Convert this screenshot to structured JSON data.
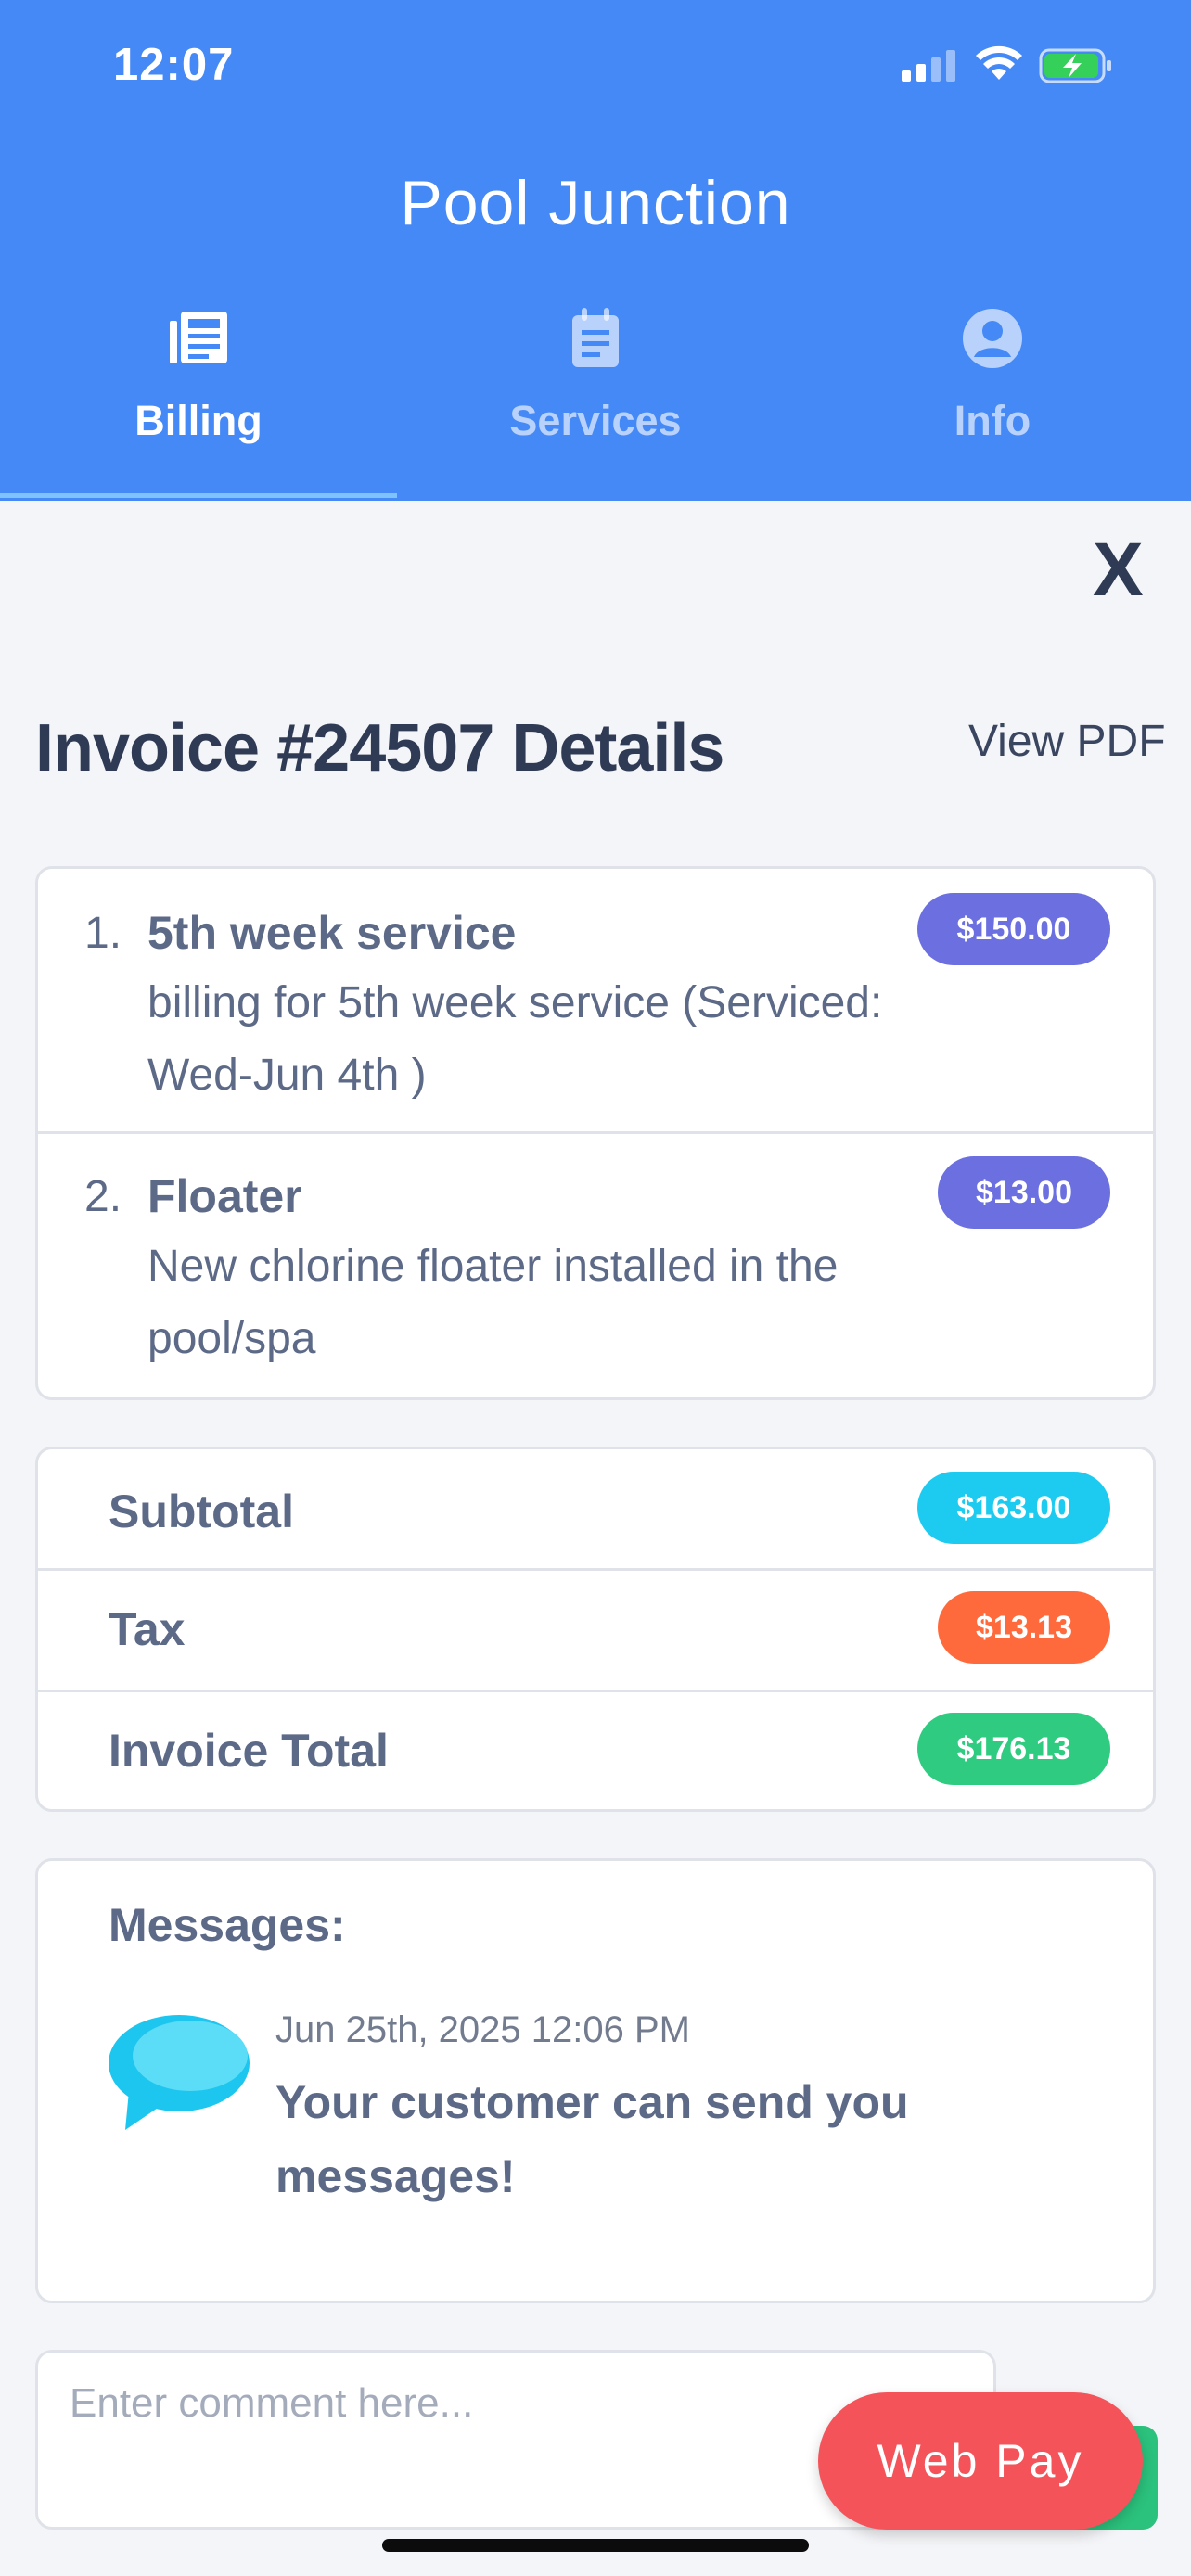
{
  "status_bar": {
    "time": "12:07"
  },
  "app": {
    "title": "Pool Junction"
  },
  "tabs": [
    {
      "label": "Billing",
      "icon": "newspaper-icon",
      "active": true
    },
    {
      "label": "Services",
      "icon": "notepad-icon",
      "active": false
    },
    {
      "label": "Info",
      "icon": "account-circle-icon",
      "active": false
    }
  ],
  "invoice": {
    "close_label": "X",
    "title": "Invoice #24507 Details",
    "view_pdf": "View PDF",
    "items": [
      {
        "number": "1.",
        "name": "5th week service",
        "description": "billing for 5th week service (Serviced: Wed-Jun 4th )",
        "price": "$150.00"
      },
      {
        "number": "2.",
        "name": "Floater",
        "description": "New chlorine floater installed in the pool/spa",
        "price": "$13.00"
      }
    ],
    "totals": [
      {
        "label": "Subtotal",
        "amount": "$163.00",
        "color": "#1ccbef"
      },
      {
        "label": "Tax",
        "amount": "$13.13",
        "color": "#ff6a3d"
      },
      {
        "label": "Invoice Total",
        "amount": "$176.13",
        "color": "#2fcb80"
      }
    ]
  },
  "messages": {
    "label": "Messages:",
    "items": [
      {
        "timestamp": "Jun 25th, 2025 12:06 PM",
        "text": "Your customer can send you messages!"
      }
    ]
  },
  "comment": {
    "placeholder": "Enter comment here...",
    "value": ""
  },
  "web_pay": {
    "label": "Web Pay"
  },
  "colors": {
    "header": "#4589f6",
    "item_pill": "#6b6fe0",
    "web_pay": "#f4535a",
    "submit": "#2bc27d"
  }
}
